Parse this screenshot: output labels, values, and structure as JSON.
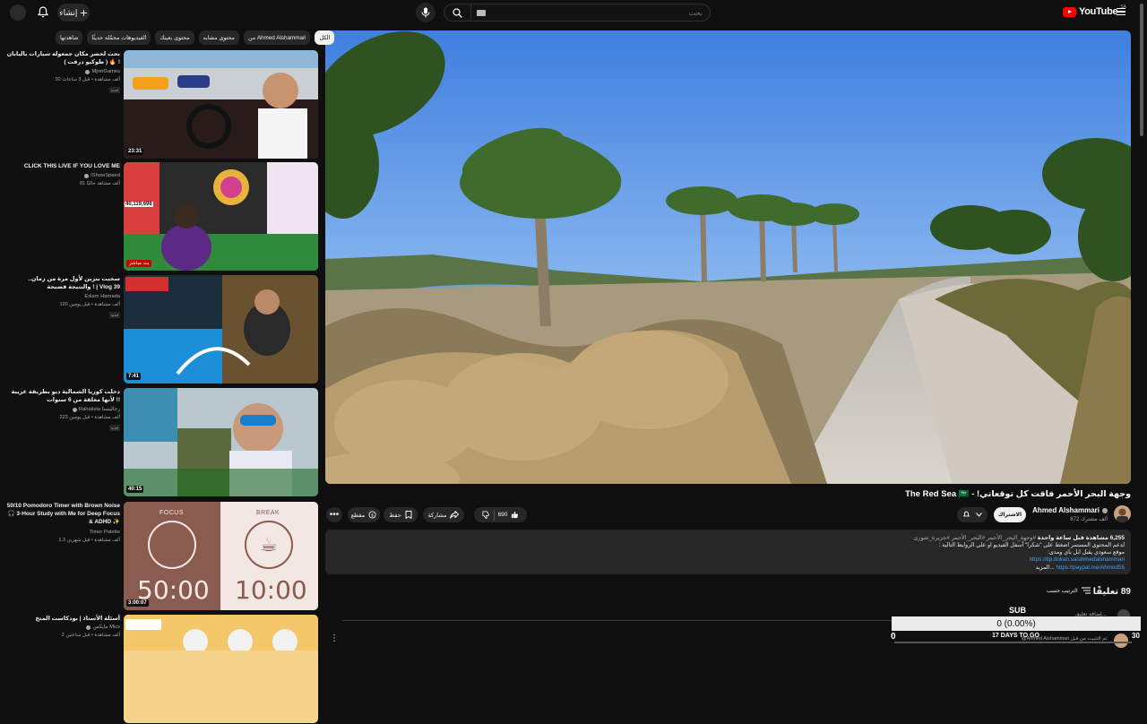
{
  "header": {
    "create_label": "إنشاء",
    "search_placeholder": "بحث",
    "logo_text": "YouTube",
    "logo_region": "SA"
  },
  "video": {
    "title": "وجهة البحر الأحمر فاقت كل توقعاتي! - The Red Sea 🇸🇦",
    "channel": "Ahmed Alshammari",
    "subscribers": "872 ألف مشترك",
    "subscribed_label": "الاشتراك",
    "likes": "690",
    "share_label": "مشاركة",
    "save_label": "حفظ",
    "clip_label": "مقطع"
  },
  "description": {
    "stats": "6,255 مشاهدة قبل ساعة واحدة",
    "tags": "#وجهة_البحر_الأحمر #البحر_الأحمر #جزيرة_شورى",
    "line1": "لدعم المحتوى المستمر اضغط على \"شكرا\" أسفل الفيديو او على الروابط التالية :",
    "line2": "موقع سعودي يقبل ابل باي ومدى:",
    "link1": "https://tip.dokan.sa/ahmedalshammari",
    "link2": "https://paypal.me/Ahmed55",
    "more": "...المزيد"
  },
  "comments": {
    "count_label": "89 تعليقًا",
    "sort_label": "الترتيب حسب",
    "add_placeholder": "إضافة تعليق...",
    "pinned_label": "تم التثبيت من قبل Ahmed Alshammari@"
  },
  "subcounter": {
    "label": "SUB",
    "value": "0 (0.00%)",
    "days": "17 DAYS TO GO",
    "start": "0",
    "end": "30"
  },
  "chips": [
    {
      "label": "الكل",
      "active": true
    },
    {
      "label": "من Ahmed Alshammari",
      "active": false
    },
    {
      "label": "محتوى مشابه",
      "active": false
    },
    {
      "label": "محتوى بعينك",
      "active": false
    },
    {
      "label": "الفيديوهات محمّلة حديثًا",
      "active": false
    },
    {
      "label": "شاهدتها",
      "active": false
    }
  ],
  "related": [
    {
      "title": "بحث لحضر مكان جمعوله سيارات باليابان ! 🔥 ( طوكيو درفت )",
      "channel": "MjrmGames",
      "meta": "92 ألف مشاهدة • قبل 3 ساعات",
      "duration": "23:31",
      "badge": "جديد"
    },
    {
      "title": "CLICK THIS LIVE IF YOU LOVE ME",
      "channel": "IShowSpeed",
      "meta": "81 ألف مشاهد حاليًا",
      "duration": "",
      "live": "بث مباشر",
      "counter": "40,119,698"
    },
    {
      "title": "سحبت بنزين لأول مرة من زمان.. والنتيجة فضيحة ! | Vlog 39",
      "channel": "Eslam Hamada",
      "meta": "120 ألف مشاهدة • قبل يومين",
      "duration": "7:41",
      "badge": "جديد"
    },
    {
      "title": "دخلت كوريا الشمالية ديو بطريقة غريبة لأنها مغلقة من 6 سنوات !!",
      "channel": "Rahalista رحاليستا",
      "meta": "223 ألف مشاهدة • قبل يومين",
      "duration": "40:15",
      "badge": "جديد"
    },
    {
      "title": "50/10 Pomodoro Timer with Brown Noise 🎧 3-Hour Study with Me for Deep Focus & ADHD ✨",
      "channel": "Timer Palette",
      "meta": "1.3 ألف مشاهدة • قبل شهرين",
      "duration": "3:00:07",
      "focus_label": "FOCUS",
      "break_label": "BREAK",
      "focus_time": "50:00",
      "break_time": "10:00"
    },
    {
      "title": "أسئلة الأستاذ | بودكاست المتخ",
      "channel": "مايكس Mics",
      "meta": "2 ألف مشاهدة • قبل ساعتين",
      "duration": "",
      "badge": "جديد"
    }
  ]
}
